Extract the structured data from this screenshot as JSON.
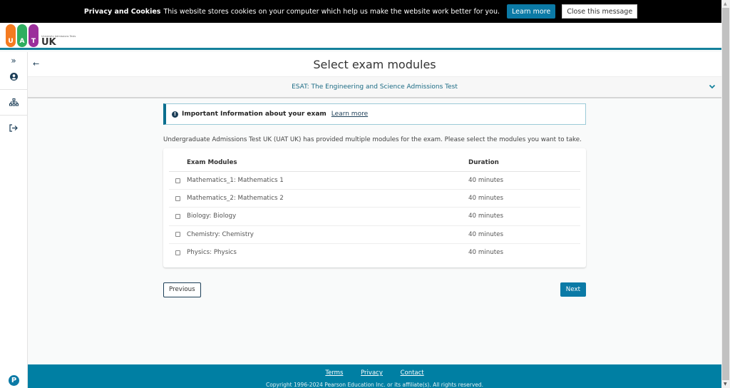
{
  "cookie": {
    "title": "Privacy and Cookies",
    "message": "This website stores cookies on your computer which help us make the website work better for you.",
    "learn_more": "Learn more",
    "close": "Close this message"
  },
  "logo": {
    "letters": [
      "U",
      "A",
      "T"
    ],
    "small_text": "University Admissions Tests",
    "uk": "UK",
    "colors": [
      "#f47b20",
      "#2fae60",
      "#9b2f9b"
    ]
  },
  "sidebar": {
    "items": [
      {
        "name": "expand",
        "icon": "»"
      },
      {
        "name": "profile",
        "icon": "person"
      },
      {
        "name": "sitemap",
        "icon": "sitemap"
      },
      {
        "name": "logout",
        "icon": "logout"
      }
    ],
    "bottom_logo": "P"
  },
  "page": {
    "back_icon": "←",
    "title": "Select exam modules",
    "exam_name": "ESAT: The Engineering and Science Admissions Test",
    "chevron": "⌄"
  },
  "info": {
    "icon": "!",
    "title": "Important Information about your exam",
    "link": "Learn more"
  },
  "description": "Undergraduate Admissions Test UK (UAT UK) has provided multiple modules for the exam. Please select the modules you want to take.",
  "table": {
    "headers": [
      "Exam Modules",
      "Duration"
    ],
    "rows": [
      {
        "module": "Mathematics_1: Mathematics 1",
        "duration": "40 minutes",
        "checked": false
      },
      {
        "module": "Mathematics_2: Mathematics 2",
        "duration": "40 minutes",
        "checked": false
      },
      {
        "module": "Biology: Biology",
        "duration": "40 minutes",
        "checked": false
      },
      {
        "module": "Chemistry: Chemistry",
        "duration": "40 minutes",
        "checked": false
      },
      {
        "module": "Physics: Physics",
        "duration": "40 minutes",
        "checked": false
      }
    ]
  },
  "actions": {
    "previous": "Previous",
    "next": "Next"
  },
  "footer": {
    "links": [
      "Terms",
      "Privacy",
      "Contact"
    ],
    "copyright": "Copyright 1996-2024 Pearson Education Inc. or its affiliate(s). All rights reserved."
  },
  "colors": {
    "accent": "#0b7aa6",
    "footer": "#007fa3",
    "header_rule": "#15819c",
    "navy": "#1c3e57"
  }
}
